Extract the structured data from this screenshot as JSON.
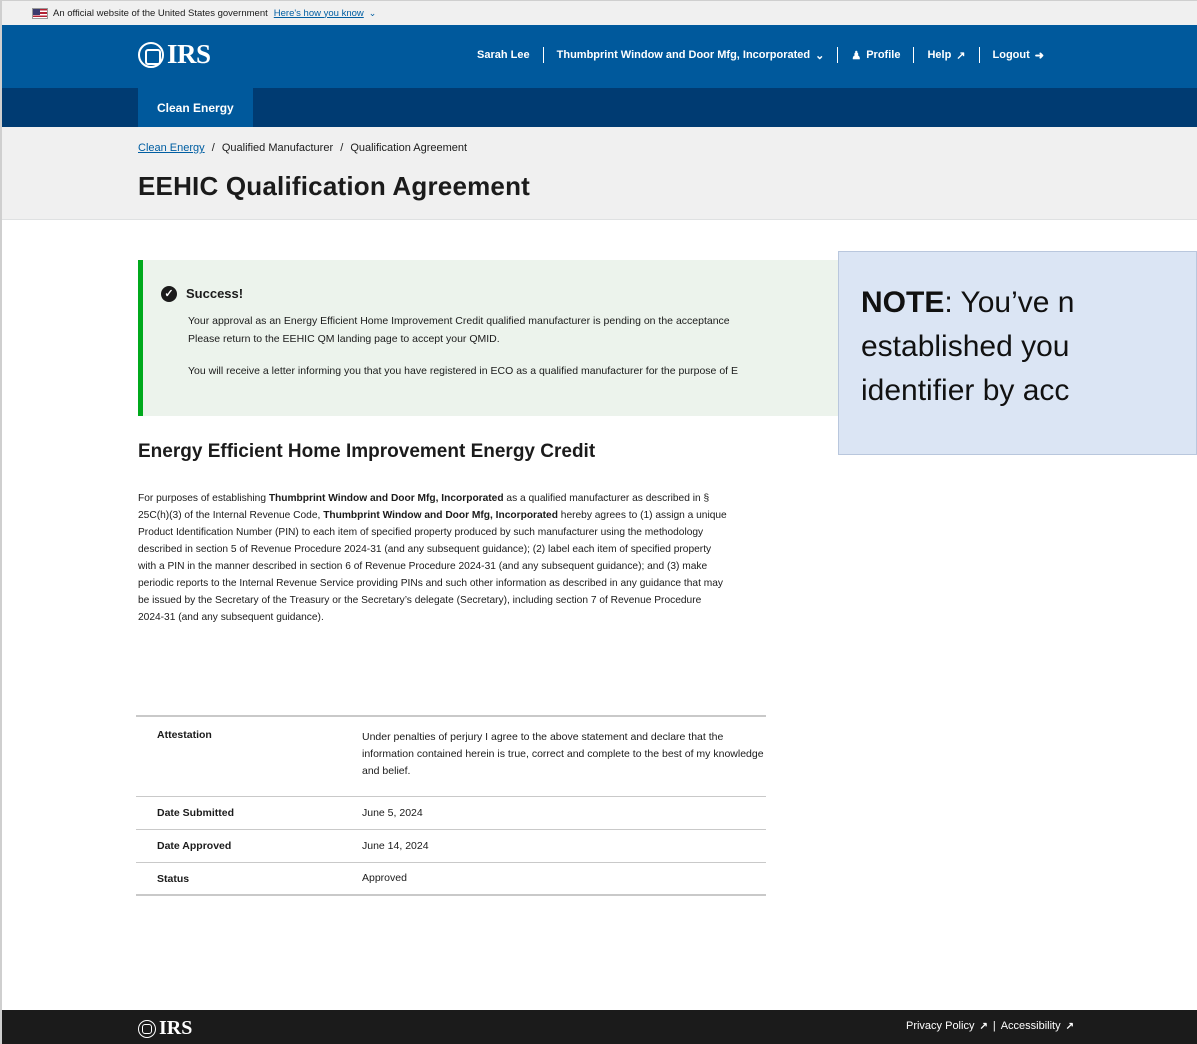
{
  "gov_banner": {
    "text": "An official website of the United States government",
    "link": "Here's how you know"
  },
  "header": {
    "logo": "IRS",
    "user_name": "Sarah Lee",
    "organization": "Thumbprint Window and Door Mfg, Incorporated",
    "profile": "Profile",
    "help": "Help",
    "logout": "Logout"
  },
  "subnav": {
    "active_tab": "Clean Energy"
  },
  "breadcrumb": {
    "items": [
      "Clean Energy",
      "Qualified Manufacturer",
      "Qualification Agreement"
    ],
    "separator": "/"
  },
  "page_title": "EEHIC Qualification Agreement",
  "alert": {
    "heading": "Success!",
    "line1": "Your approval as an Energy Efficient Home Improvement Credit qualified manufacturer is pending on the acceptance",
    "line2": "Please return to the EEHIC QM landing page to accept your QMID.",
    "line3": "You will receive a letter informing you that you have registered in ECO as a qualified manufacturer for the purpose of E"
  },
  "callout": {
    "label": "NOTE",
    "line1_rest": ": You’ve n",
    "line2": "established you",
    "line3": "identifier by acc"
  },
  "section": {
    "title": "Energy Efficient Home Improvement Energy Credit",
    "p_1": "For purposes of establishing ",
    "company": "Thumbprint Window and Door Mfg, Incorporated",
    "p_2": " as a qualified manufacturer as described in § 25C(h)(3) of the Internal Revenue Code, ",
    "p_3": " hereby agrees to (1) assign a unique Product Identification Number (PIN) to each item of specified property produced by such manufacturer using the methodology described in section 5 of Revenue Procedure 2024-31 (and any subsequent guidance); (2) label each item of specified property with a PIN in the manner described in section 6 of Revenue Procedure 2024-31 (and any subsequent guidance); and (3) make periodic reports to the Internal Revenue Service providing PINs and such other information as described in any guidance that may be issued by the Secretary of the Treasury or the Secretary’s delegate (Secretary), including section 7 of Revenue Procedure 2024-31 (and any subsequent guidance)."
  },
  "details": [
    {
      "label": "Attestation",
      "value": "Under penalties of perjury I agree to the above statement and declare that the information contained herein is true, correct and complete to the best of my knowledge and belief."
    },
    {
      "label": "Date Submitted",
      "value": "June 5, 2024"
    },
    {
      "label": "Date Approved",
      "value": "June 14, 2024"
    },
    {
      "label": "Status",
      "value": "Approved"
    }
  ],
  "footer": {
    "logo": "IRS",
    "privacy": "Privacy Policy",
    "divider": "|",
    "accessibility": "Accessibility"
  }
}
